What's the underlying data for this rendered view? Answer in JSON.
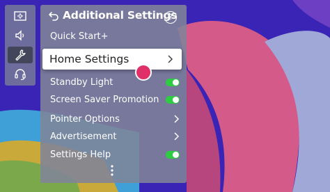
{
  "colors": {
    "accent_toggle": "#2ecc40",
    "panel_bg": "#80849a",
    "focus_bg": "#ffffff",
    "cursor": "#e0306a"
  },
  "rail": {
    "items": [
      {
        "icon": "picture-mode-icon"
      },
      {
        "icon": "sound-icon"
      },
      {
        "icon": "wrench-icon"
      },
      {
        "icon": "headset-icon"
      }
    ]
  },
  "panel": {
    "title": "Additional Settings",
    "help_glyph": "?",
    "items": [
      {
        "label": "Quick Start+",
        "control": "none"
      },
      {
        "label": "Home Settings",
        "control": "chevron",
        "focused": true
      },
      {
        "label": "Standby Light",
        "control": "toggle",
        "state": "on"
      },
      {
        "label": "Screen Saver Promotion",
        "control": "toggle",
        "state": "on"
      },
      {
        "label": "Pointer Options",
        "control": "chevron"
      },
      {
        "label": "Advertisement",
        "control": "chevron"
      },
      {
        "label": "Settings Help",
        "control": "toggle",
        "state": "on"
      }
    ]
  }
}
